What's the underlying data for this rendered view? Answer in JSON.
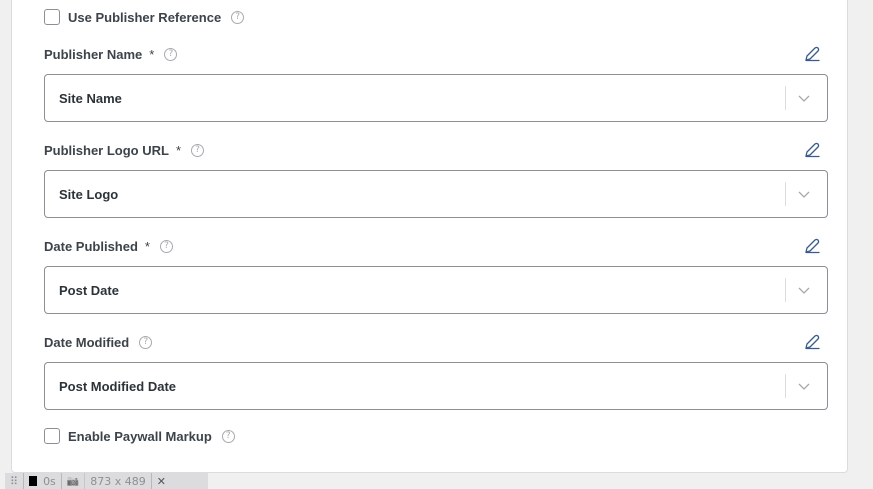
{
  "publisher_reference": {
    "label": "Use Publisher Reference",
    "help": "?"
  },
  "fields": [
    {
      "label": "Publisher Name",
      "required": "*",
      "help": "?",
      "value": "Site Name"
    },
    {
      "label": "Publisher Logo URL",
      "required": "*",
      "help": "?",
      "value": "Site Logo"
    },
    {
      "label": "Date Published",
      "required": "*",
      "help": "?",
      "value": "Post Date"
    },
    {
      "label": "Date Modified",
      "required": "",
      "help": "?",
      "value": "Post Modified Date"
    }
  ],
  "paywall": {
    "label": "Enable Paywall Markup",
    "help": "?"
  },
  "devbar": {
    "grip": "⠿",
    "timing": "0s",
    "camera": "📷",
    "dimensions": "873 x 489",
    "close": "✕"
  },
  "colors": {
    "edit_icon": "#3a5a8c",
    "border": "#8c8f94",
    "text": "#3c434a"
  }
}
